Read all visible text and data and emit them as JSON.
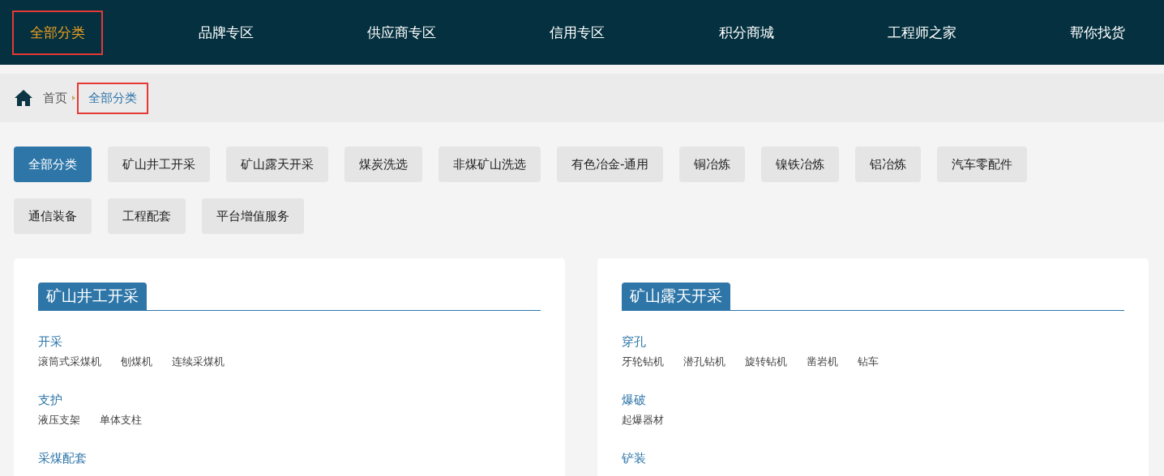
{
  "nav": [
    {
      "label": "全部分类",
      "selected": true,
      "highlighted": true
    },
    {
      "label": "品牌专区",
      "selected": false,
      "highlighted": false
    },
    {
      "label": "供应商专区",
      "selected": false,
      "highlighted": false
    },
    {
      "label": "信用专区",
      "selected": false,
      "highlighted": false
    },
    {
      "label": "积分商城",
      "selected": false,
      "highlighted": false
    },
    {
      "label": "工程师之家",
      "selected": false,
      "highlighted": false
    },
    {
      "label": "帮你找货",
      "selected": false,
      "highlighted": false
    }
  ],
  "breadcrumb": [
    {
      "label": "首页",
      "highlighted": false
    },
    {
      "label": "全部分类",
      "highlighted": true
    }
  ],
  "categories": [
    {
      "label": "全部分类",
      "selected": true
    },
    {
      "label": "矿山井工开采",
      "selected": false
    },
    {
      "label": "矿山露天开采",
      "selected": false
    },
    {
      "label": "煤炭洗选",
      "selected": false
    },
    {
      "label": "非煤矿山洗选",
      "selected": false
    },
    {
      "label": "有色冶金-通用",
      "selected": false
    },
    {
      "label": "铜冶炼",
      "selected": false
    },
    {
      "label": "镍铁冶炼",
      "selected": false
    },
    {
      "label": "铝冶炼",
      "selected": false
    },
    {
      "label": "汽车零配件",
      "selected": false
    },
    {
      "label": "通信装备",
      "selected": false
    },
    {
      "label": "工程配套",
      "selected": false
    },
    {
      "label": "平台增值服务",
      "selected": false
    }
  ],
  "panels": [
    {
      "title": "矿山井工开采",
      "groups": [
        {
          "name": "开采",
          "items": [
            "滚筒式采煤机",
            "刨煤机",
            "连续采煤机"
          ]
        },
        {
          "name": "支护",
          "items": [
            "液压支架",
            "单体支柱"
          ]
        },
        {
          "name": "采煤配套"
        }
      ]
    },
    {
      "title": "矿山露天开采",
      "groups": [
        {
          "name": "穿孔",
          "items": [
            "牙轮钻机",
            "潜孔钻机",
            "旋转钻机",
            "凿岩机",
            "钻车"
          ]
        },
        {
          "name": "爆破",
          "items": [
            "起爆器材"
          ]
        },
        {
          "name": "铲装"
        }
      ]
    }
  ]
}
